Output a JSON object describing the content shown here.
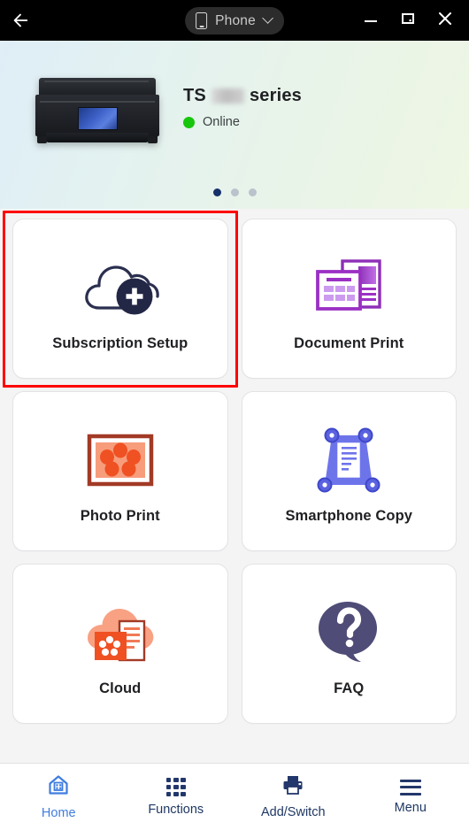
{
  "titlebar": {
    "back_icon": "arrow-left-icon",
    "device_pill": {
      "icon": "phone-icon",
      "label": "Phone",
      "chevron": "chevron-down-icon"
    },
    "window_controls": {
      "minimize": "minimize-icon",
      "maximize": "restore-icon",
      "close": "close-icon"
    }
  },
  "hero": {
    "printer_image": "printer-illustration",
    "title_prefix": "TS",
    "title_suffix": "series",
    "model_redacted": true,
    "status": "Online",
    "status_color": "#16c60c",
    "pager": {
      "total": 3,
      "active_index": 0
    }
  },
  "cards": [
    {
      "id": "subscription-setup",
      "label": "Subscription Setup",
      "icon": "cloud-plus-icon",
      "highlighted": true
    },
    {
      "id": "document-print",
      "label": "Document Print",
      "icon": "document-print-icon",
      "highlighted": false
    },
    {
      "id": "photo-print",
      "label": "Photo Print",
      "icon": "photo-print-icon",
      "highlighted": false
    },
    {
      "id": "smartphone-copy",
      "label": "Smartphone Copy",
      "icon": "smartphone-copy-icon",
      "highlighted": false
    },
    {
      "id": "cloud",
      "label": "Cloud",
      "icon": "cloud-document-icon",
      "highlighted": false
    },
    {
      "id": "faq",
      "label": "FAQ",
      "icon": "question-bubble-icon",
      "highlighted": false
    }
  ],
  "bottom_nav": {
    "active": "Home",
    "items": [
      {
        "id": "home",
        "label": "Home",
        "icon": "home-icon"
      },
      {
        "id": "functions",
        "label": "Functions",
        "icon": "grid-dots-icon"
      },
      {
        "id": "add-switch",
        "label": "Add/Switch",
        "icon": "printer-icon"
      },
      {
        "id": "menu",
        "label": "Menu",
        "icon": "hamburger-icon"
      }
    ]
  },
  "colors": {
    "accent_blue": "#3f7de0",
    "nav_navy": "#22376b",
    "highlight_red": "#ff0000",
    "online_green": "#16c60c",
    "card_bg": "#ffffff",
    "page_bg": "#f4f4f5"
  }
}
